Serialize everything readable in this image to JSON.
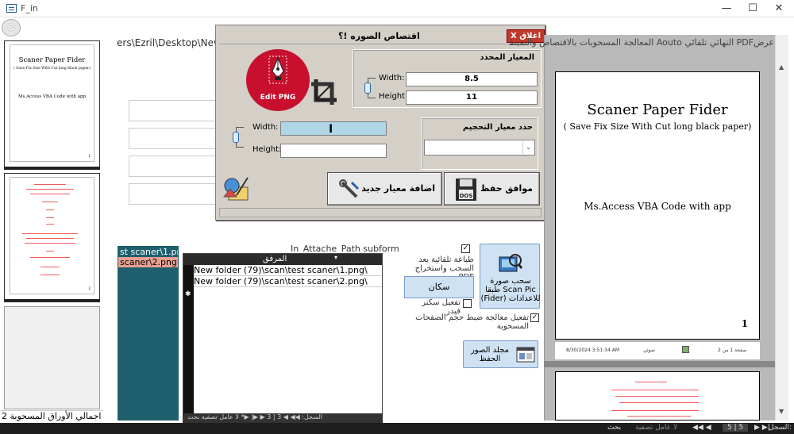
{
  "window": {
    "title": "F_in",
    "minimize": "—",
    "maximize": "☐",
    "close": "✕"
  },
  "thumbnails": {
    "page1": {
      "title": "Scaner Paper Fider",
      "subtitle": "( Save Fix Size With Cut long black paper)",
      "body": "Ms.Access VBA Code with app",
      "number": "1"
    },
    "page2": {
      "number": "2"
    },
    "count_label": "اجمالي الأوراق المسحوبة 2"
  },
  "main": {
    "path_text": "ers\\Ezril\\Desktop\\New fold"
  },
  "dialog": {
    "title": "اقتصاص الصوره !؟",
    "close_label": "اغلاق X",
    "logo_label": "Edit PNG",
    "selected_group": {
      "title": "المعيار المحدد",
      "width_label": "Width:",
      "width_value": "8.5",
      "height_label": "Height:",
      "height_value": "11"
    },
    "size_group": {
      "title": "حدد معيار التحجيم"
    },
    "input": {
      "width_label": "Width:",
      "height_label": "Height:",
      "width_value": "",
      "height_value": ""
    },
    "add_button": "اضافة معيار جديد",
    "save_button": "موافق حفظ"
  },
  "preview": {
    "caption": "عرضPDF النهائي تلقائي Aouto المعالجة المسحوبات بالاقتصاص والضبط",
    "title": "Scaner Paper Fider",
    "subtitle": "( Save Fix Size With Cut long black paper)",
    "body": "Ms.Access VBA Code with app",
    "number": "1",
    "footer_date": "8/30/2024 3:51:34 AM",
    "footer_right": "صفحة 1 من 2",
    "footer_mid": "ضوئي"
  },
  "controls": {
    "scan_button": "سحب صورة Scan Pic طبقا للاعدادات (Fider)",
    "scanner_button": "سكان",
    "auto_print_label": "طباعة تلقائية بعد السحب واستخراج PDF",
    "auto_print_checked": true,
    "enable_scanner_label": "تفعيل سكنر فيدر",
    "enable_scanner_checked": false,
    "resize_label": "تفعيل معالجة ضبط حجم الصفحات المسحوبة",
    "resize_checked": true,
    "folder_button": "مجلد الصور الحفظ"
  },
  "attachments": {
    "caption": "In_Attache_Path subform",
    "files": [
      "st scaner\\1.png",
      "scaner\\2.png"
    ],
    "grid_header": "المرفق",
    "rows": [
      "\\New folder (79)\\scan\\test scaner\\1.png",
      "\\New folder (79)\\scan\\test scaner\\2.png"
    ],
    "nav": "السجل: ◀◀ ◀ 3 | 3 ▶ ▶| ▶* لا عامل تصفية بحث"
  },
  "statusbar": {
    "record_label": "السجل:",
    "position": "5 | 5",
    "filter_label": "لا عامل تصفية",
    "search_label": "بحث"
  },
  "colors": {
    "logo_red": "#c8102e",
    "highlight_blue": "#aed6e6",
    "list_teal": "#1f5f6e",
    "button_blue": "#cfe2f3"
  }
}
